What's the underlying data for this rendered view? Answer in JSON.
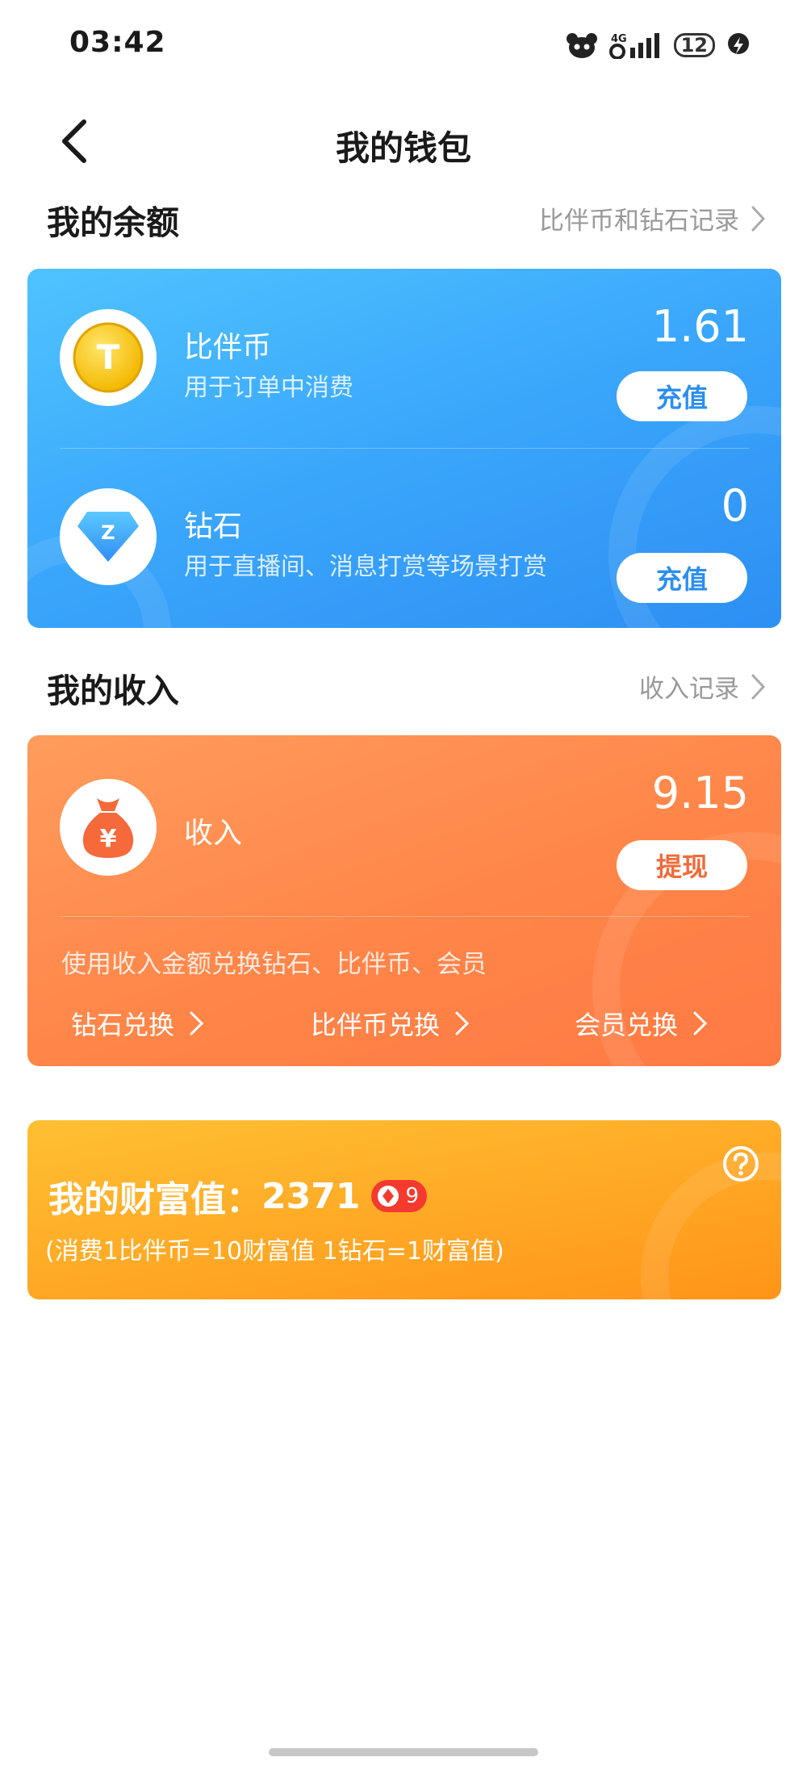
{
  "status_bar": {
    "time": "03:42",
    "network": "4G",
    "battery": "12"
  },
  "header": {
    "title": "我的钱包"
  },
  "balance_section": {
    "title": "我的余额",
    "record_link": "比伴币和钻石记录"
  },
  "balance_items": [
    {
      "name": "比伴币",
      "desc": "用于订单中消费",
      "amount": "1.61",
      "action": "充值",
      "icon_letter": "T"
    },
    {
      "name": "钻石",
      "desc": "用于直播间、消息打赏等场景打赏",
      "amount": "0",
      "action": "充值",
      "icon_letter": "Z"
    }
  ],
  "income_section": {
    "title": "我的收入",
    "record_link": "收入记录"
  },
  "income": {
    "name": "收入",
    "amount": "9.15",
    "action": "提现",
    "icon_symbol": "¥",
    "hint": "使用收入金额兑换钻石、比伴币、会员",
    "exchange_links": [
      "钻石兑换",
      "比伴币兑换",
      "会员兑换"
    ]
  },
  "wealth": {
    "label": "我的财富值：",
    "value": "2371",
    "level": "9",
    "note": "(消费1比伴币=10财富值 1钻石=1财富值)"
  },
  "colors": {
    "blue_card": "#3aa6fb",
    "orange_card": "#ff8548",
    "gold_card": "#ffa825",
    "badge": "#f43a2f"
  }
}
